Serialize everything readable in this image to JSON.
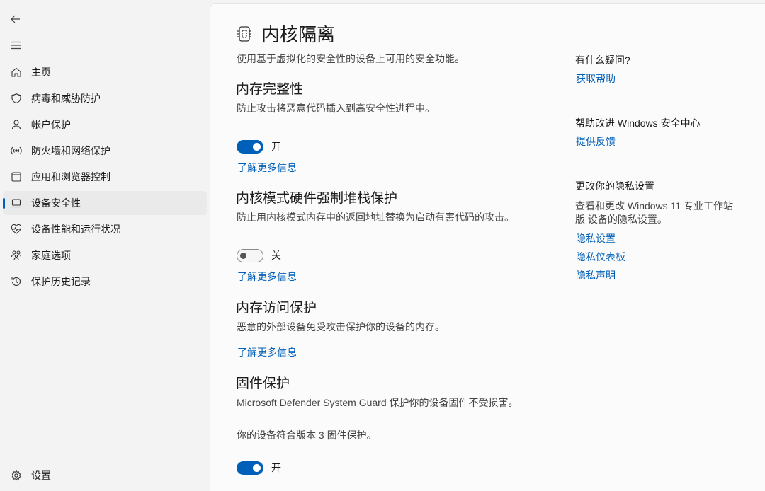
{
  "sidebar": {
    "items": [
      {
        "label": "主页",
        "icon": "home-icon"
      },
      {
        "label": "病毒和威胁防护",
        "icon": "shield-icon"
      },
      {
        "label": "帐户保护",
        "icon": "person-icon"
      },
      {
        "label": "防火墙和网络保护",
        "icon": "wireless-icon"
      },
      {
        "label": "应用和浏览器控制",
        "icon": "app-window-icon"
      },
      {
        "label": "设备安全性",
        "icon": "laptop-icon",
        "selected": true
      },
      {
        "label": "设备性能和运行状况",
        "icon": "heart-pulse-icon"
      },
      {
        "label": "家庭选项",
        "icon": "family-icon"
      },
      {
        "label": "保护历史记录",
        "icon": "history-icon"
      }
    ],
    "settings_label": "设置"
  },
  "page": {
    "title": "内核隔离",
    "description": "使用基于虚拟化的安全性的设备上可用的安全功能。"
  },
  "sections": {
    "memory_integrity": {
      "title": "内存完整性",
      "description": "防止攻击将恶意代码插入到高安全性进程中。",
      "toggle_state": "开",
      "toggle_on": true,
      "link": "了解更多信息"
    },
    "stack_protection": {
      "title": "内核模式硬件强制堆栈保护",
      "description": "防止用内核模式内存中的返回地址替换为启动有害代码的攻击。",
      "toggle_state": "关",
      "toggle_on": false,
      "link": "了解更多信息"
    },
    "memory_access": {
      "title": "内存访问保护",
      "description": "恶意的外部设备免受攻击保护你的设备的内存。",
      "link": "了解更多信息"
    },
    "firmware": {
      "title": "固件保护",
      "description": "Microsoft Defender System Guard 保护你的设备固件不受损害。",
      "note": "你的设备符合版本 3 固件保护。",
      "toggle_state": "开",
      "toggle_on": true
    }
  },
  "aside": {
    "questions_heading": "有什么疑问?",
    "get_help": "获取帮助",
    "improve_heading": "帮助改进 Windows 安全中心",
    "feedback": "提供反馈",
    "privacy_heading": "更改你的隐私设置",
    "privacy_text": "查看和更改 Windows 11 专业工作站版 设备的隐私设置。",
    "privacy_settings": "隐私设置",
    "privacy_dashboard": "隐私仪表板",
    "privacy_statement": "隐私声明"
  },
  "colors": {
    "accent": "#005fb8",
    "background": "#f3f3f3",
    "card": "#fbfbfb"
  }
}
